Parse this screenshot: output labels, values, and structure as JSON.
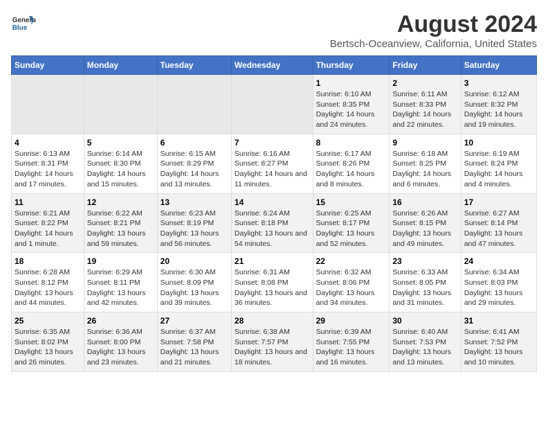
{
  "header": {
    "logo_line1": "General",
    "logo_line2": "Blue",
    "main_title": "August 2024",
    "subtitle": "Bertsch-Oceanview, California, United States"
  },
  "days_of_week": [
    "Sunday",
    "Monday",
    "Tuesday",
    "Wednesday",
    "Thursday",
    "Friday",
    "Saturday"
  ],
  "weeks": [
    [
      {
        "day": "",
        "empty": true
      },
      {
        "day": "",
        "empty": true
      },
      {
        "day": "",
        "empty": true
      },
      {
        "day": "",
        "empty": true
      },
      {
        "day": "1",
        "sunrise": "6:10 AM",
        "sunset": "8:35 PM",
        "daylight": "14 hours and 24 minutes."
      },
      {
        "day": "2",
        "sunrise": "6:11 AM",
        "sunset": "8:33 PM",
        "daylight": "14 hours and 22 minutes."
      },
      {
        "day": "3",
        "sunrise": "6:12 AM",
        "sunset": "8:32 PM",
        "daylight": "14 hours and 19 minutes."
      }
    ],
    [
      {
        "day": "4",
        "sunrise": "6:13 AM",
        "sunset": "8:31 PM",
        "daylight": "14 hours and 17 minutes."
      },
      {
        "day": "5",
        "sunrise": "6:14 AM",
        "sunset": "8:30 PM",
        "daylight": "14 hours and 15 minutes."
      },
      {
        "day": "6",
        "sunrise": "6:15 AM",
        "sunset": "8:29 PM",
        "daylight": "14 hours and 13 minutes."
      },
      {
        "day": "7",
        "sunrise": "6:16 AM",
        "sunset": "8:27 PM",
        "daylight": "14 hours and 11 minutes."
      },
      {
        "day": "8",
        "sunrise": "6:17 AM",
        "sunset": "8:26 PM",
        "daylight": "14 hours and 8 minutes."
      },
      {
        "day": "9",
        "sunrise": "6:18 AM",
        "sunset": "8:25 PM",
        "daylight": "14 hours and 6 minutes."
      },
      {
        "day": "10",
        "sunrise": "6:19 AM",
        "sunset": "8:24 PM",
        "daylight": "14 hours and 4 minutes."
      }
    ],
    [
      {
        "day": "11",
        "sunrise": "6:21 AM",
        "sunset": "8:22 PM",
        "daylight": "14 hours and 1 minute."
      },
      {
        "day": "12",
        "sunrise": "6:22 AM",
        "sunset": "8:21 PM",
        "daylight": "13 hours and 59 minutes."
      },
      {
        "day": "13",
        "sunrise": "6:23 AM",
        "sunset": "8:19 PM",
        "daylight": "13 hours and 56 minutes."
      },
      {
        "day": "14",
        "sunrise": "6:24 AM",
        "sunset": "8:18 PM",
        "daylight": "13 hours and 54 minutes."
      },
      {
        "day": "15",
        "sunrise": "6:25 AM",
        "sunset": "8:17 PM",
        "daylight": "13 hours and 52 minutes."
      },
      {
        "day": "16",
        "sunrise": "6:26 AM",
        "sunset": "8:15 PM",
        "daylight": "13 hours and 49 minutes."
      },
      {
        "day": "17",
        "sunrise": "6:27 AM",
        "sunset": "8:14 PM",
        "daylight": "13 hours and 47 minutes."
      }
    ],
    [
      {
        "day": "18",
        "sunrise": "6:28 AM",
        "sunset": "8:12 PM",
        "daylight": "13 hours and 44 minutes."
      },
      {
        "day": "19",
        "sunrise": "6:29 AM",
        "sunset": "8:11 PM",
        "daylight": "13 hours and 42 minutes."
      },
      {
        "day": "20",
        "sunrise": "6:30 AM",
        "sunset": "8:09 PM",
        "daylight": "13 hours and 39 minutes."
      },
      {
        "day": "21",
        "sunrise": "6:31 AM",
        "sunset": "8:08 PM",
        "daylight": "13 hours and 36 minutes."
      },
      {
        "day": "22",
        "sunrise": "6:32 AM",
        "sunset": "8:06 PM",
        "daylight": "13 hours and 34 minutes."
      },
      {
        "day": "23",
        "sunrise": "6:33 AM",
        "sunset": "8:05 PM",
        "daylight": "13 hours and 31 minutes."
      },
      {
        "day": "24",
        "sunrise": "6:34 AM",
        "sunset": "8:03 PM",
        "daylight": "13 hours and 29 minutes."
      }
    ],
    [
      {
        "day": "25",
        "sunrise": "6:35 AM",
        "sunset": "8:02 PM",
        "daylight": "13 hours and 26 minutes."
      },
      {
        "day": "26",
        "sunrise": "6:36 AM",
        "sunset": "8:00 PM",
        "daylight": "13 hours and 23 minutes."
      },
      {
        "day": "27",
        "sunrise": "6:37 AM",
        "sunset": "7:58 PM",
        "daylight": "13 hours and 21 minutes."
      },
      {
        "day": "28",
        "sunrise": "6:38 AM",
        "sunset": "7:57 PM",
        "daylight": "13 hours and 18 minutes."
      },
      {
        "day": "29",
        "sunrise": "6:39 AM",
        "sunset": "7:55 PM",
        "daylight": "13 hours and 16 minutes."
      },
      {
        "day": "30",
        "sunrise": "6:40 AM",
        "sunset": "7:53 PM",
        "daylight": "13 hours and 13 minutes."
      },
      {
        "day": "31",
        "sunrise": "6:41 AM",
        "sunset": "7:52 PM",
        "daylight": "13 hours and 10 minutes."
      }
    ]
  ]
}
